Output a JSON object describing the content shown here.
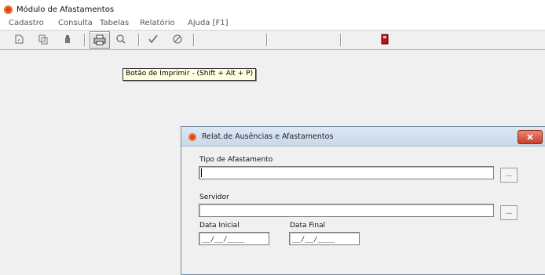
{
  "window": {
    "title": "Módulo de Afastamentos",
    "icon": "app-logo-icon"
  },
  "menu": [
    "Cadastro",
    "Consulta",
    "Tabelas",
    "Relatório",
    "Ajuda [F1]"
  ],
  "toolbar": {
    "buttons": [
      "new-record-icon",
      "copy-icon",
      "delete-icon",
      "print-icon",
      "search-icon",
      "confirm-icon",
      "cancel-icon",
      "exit-icon"
    ],
    "pressed": "print-icon",
    "exit_color": "#c0101a"
  },
  "tooltip": "Botão de Imprimir - (Shift + Alt + P)",
  "dialog": {
    "title": "Relat.de Ausências e Afastamentos",
    "tipo_label": "Tipo de Afastamento",
    "tipo_value": "",
    "servidor_label": "Servidor",
    "servidor_value": "",
    "lookup_label": "...",
    "data_inicial_label": "Data Inicial",
    "data_final_label": "Data Final",
    "date_mask": "__/__/____",
    "close_color": "#c6402a"
  }
}
